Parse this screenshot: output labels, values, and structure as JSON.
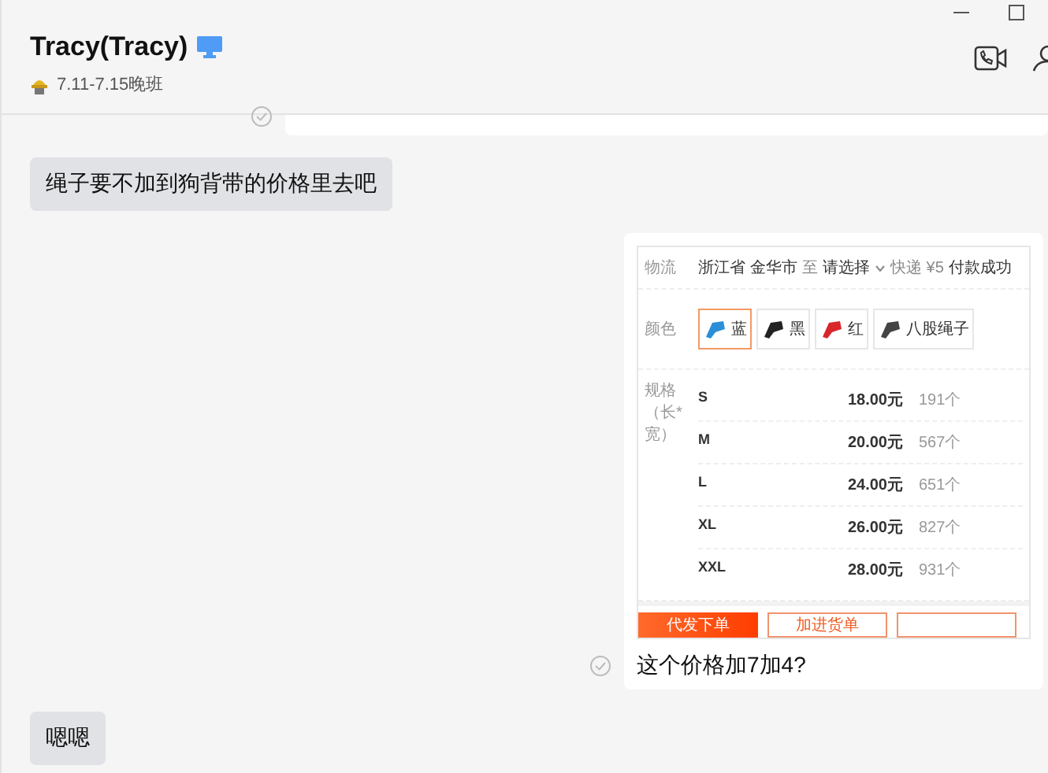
{
  "header": {
    "title": "Tracy(Tracy)",
    "status": "7.11-7.15晚班"
  },
  "messages": [
    {
      "kind": "partial",
      "outgoing": true,
      "read": true
    },
    {
      "kind": "text",
      "outgoing": false,
      "text": "绳子要不加到狗背带的价格里去吧"
    },
    {
      "kind": "image",
      "outgoing": true,
      "read": true,
      "caption": "这个价格加7加4?",
      "screenshot": {
        "shipping": {
          "label": "物流",
          "origin": "浙江省 金华市",
          "to": "至",
          "destination": "请选择",
          "method": "快递",
          "fee": "¥5",
          "note": "付款成功"
        },
        "colors": {
          "label": "颜色",
          "options": [
            {
              "name": "蓝",
              "color": "#2a8fd6",
              "selected": true
            },
            {
              "name": "黑",
              "color": "#222222",
              "selected": false
            },
            {
              "name": "红",
              "color": "#d9262b",
              "selected": false
            },
            {
              "name": "八股绳子",
              "color": "#444444",
              "selected": false
            }
          ]
        },
        "sizes": {
          "label": "规格（长*宽）",
          "rows": [
            {
              "size": "S",
              "price": "18.00元",
              "stock": "191个"
            },
            {
              "size": "M",
              "price": "20.00元",
              "stock": "567个"
            },
            {
              "size": "L",
              "price": "24.00元",
              "stock": "651个"
            },
            {
              "size": "XL",
              "price": "26.00元",
              "stock": "827个"
            },
            {
              "size": "XXL",
              "price": "28.00元",
              "stock": "931个"
            }
          ]
        },
        "buttons": [
          {
            "label": "代发下单",
            "kind": "primary"
          },
          {
            "label": "加进货单",
            "kind": "outline"
          },
          {
            "kind": "outline"
          }
        ]
      }
    },
    {
      "kind": "text",
      "outgoing": false,
      "text": "嗯嗯"
    }
  ]
}
